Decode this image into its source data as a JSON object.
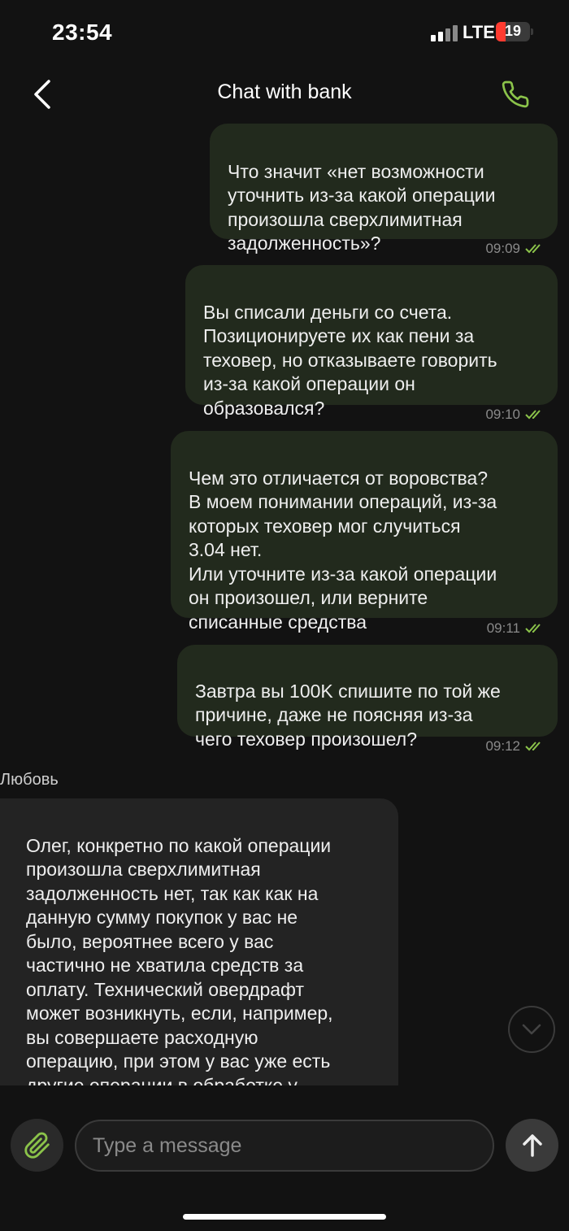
{
  "status_bar": {
    "time": "23:54",
    "network": "LTE",
    "battery": "19"
  },
  "header": {
    "title": "Chat with bank"
  },
  "colors": {
    "accent": "#8bc34a",
    "outgoing_bubble": "#222a1d",
    "incoming_bubble": "#232323"
  },
  "messages": [
    {
      "direction": "out",
      "text": "Что значит «нет возможности\nуточнить из-за какой операции\nпроизошла сверхлимитная\nзадолженность»?",
      "time": "09:09"
    },
    {
      "direction": "out",
      "text": "Вы списали деньги со счета.\nПозиционируете их как пени за\nтеховер, но отказываете говорить\nиз-за какой операции он\nобразовался?",
      "time": "09:10"
    },
    {
      "direction": "out",
      "text": "Чем это отличается от воровства?\nВ моем понимании операций, из-за\nкоторых теховер мог случиться\n3.04 нет.\nИли уточните из-за какой операции\nон произошел, или верните\nсписанные средства",
      "time": "09:11"
    },
    {
      "direction": "out",
      "text": "Завтра вы 100K спишите по той же\nпричине, даже не поясняя из-за\nчего теховер произошел?",
      "time": "09:12"
    },
    {
      "direction": "in",
      "sender": "Любовь",
      "text": "Олег,   конкретно по какой операции\nпроизошла сверхлимитная\nзадолженность нет, так как как на\nданную сумму покупок у вас не\nбыло, вероятнее всего у вас\nчастично не хватила средств за\nоплату.  Технический овердрафт\nможет возникнуть, если, например,\nвы совершаете расходную\nоперацию, при этом у вас уже есть\nдругие операции в обработке у\nплатежной системы, но сумма"
    }
  ],
  "composer": {
    "placeholder": "Type a message"
  }
}
